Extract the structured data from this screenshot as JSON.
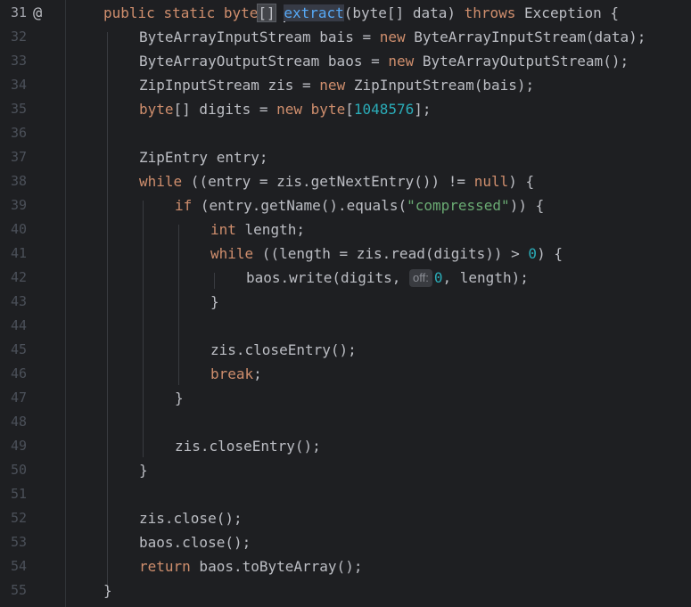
{
  "editor": {
    "line_numbers": [
      "31",
      "32",
      "33",
      "34",
      "35",
      "36",
      "37",
      "38",
      "39",
      "40",
      "41",
      "42",
      "43",
      "44",
      "45",
      "46",
      "47",
      "48",
      "49",
      "50",
      "51",
      "52",
      "53",
      "54",
      "55"
    ],
    "gutter_icon": "@",
    "inlay_hint": "off:",
    "colors": {
      "background": "#1e1f22",
      "keyword": "#cf8e6d",
      "number": "#2aacb8",
      "string": "#6aab73",
      "function": "#56a8f5",
      "text": "#bcbec4"
    },
    "lines": [
      "public static byte[] extract(byte[] data) throws Exception {",
      "    ByteArrayInputStream bais = new ByteArrayInputStream(data);",
      "    ByteArrayOutputStream baos = new ByteArrayOutputStream();",
      "    ZipInputStream zis = new ZipInputStream(bais);",
      "    byte[] digits = new byte[1048576];",
      "",
      "    ZipEntry entry;",
      "    while ((entry = zis.getNextEntry()) != null) {",
      "        if (entry.getName().equals(\"compressed\")) {",
      "            int length;",
      "            while ((length = zis.read(digits)) > 0) {",
      "                baos.write(digits, 0, length);",
      "            }",
      "",
      "            zis.closeEntry();",
      "            break;",
      "        }",
      "",
      "        zis.closeEntry();",
      "    }",
      "",
      "    zis.close();",
      "    baos.close();",
      "    return baos.toByteArray();",
      "}"
    ],
    "t": {
      "public": "public",
      "static": "static",
      "byte": "byte",
      "extract": "extract",
      "sig_params": "(byte[] data) ",
      "throws": "throws",
      "exception_brace": " Exception {",
      "l32a": "ByteArrayInputStream bais = ",
      "new": "new",
      "l32b": " ByteArrayInputStream(data);",
      "l33a": "ByteArrayOutputStream baos = ",
      "l33b": " ByteArrayOutputStream();",
      "l34a": "ZipInputStream zis = ",
      "l34b": " ZipInputStream(bais);",
      "l35a": "[] digits = ",
      "l35b": "[",
      "l35num": "1048576",
      "l35c": "];",
      "l37": "ZipEntry entry;",
      "while": "while",
      "l38a": " ((entry = zis.getNextEntry()) != ",
      "null": "null",
      "l38b": ") {",
      "if": "if",
      "l39a": " (entry.getName().equals(",
      "l39str": "\"compressed\"",
      "l39b": ")) {",
      "int": "int",
      "l40": " length;",
      "l41a": " ((length = zis.read(digits)) > ",
      "zero": "0",
      "l41b": ") {",
      "l42a": "baos.write(digits, ",
      "l42b": ", length);",
      "brace_close": "}",
      "l45": "zis.closeEntry();",
      "break": "break",
      "semi": ";",
      "l49": "zis.closeEntry();",
      "l52": "zis.close();",
      "l53": "baos.close();",
      "return": "return",
      "l54": " baos.toByteArray();"
    }
  }
}
